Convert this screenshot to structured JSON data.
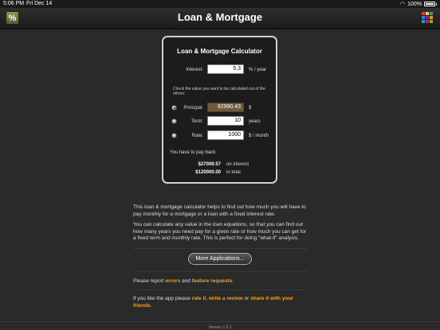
{
  "status": {
    "time": "5:06 PM",
    "date": "Fri Dec 14",
    "battery": "100%"
  },
  "header": {
    "title": "Loan & Mortgage",
    "calc_icon_glyph": "%"
  },
  "calculator": {
    "title": "Loan & Mortgage Calculator",
    "interest_label": "Interest:",
    "interest_value": "5.3",
    "interest_unit": "% / year",
    "hint": "Check the value you want to be calculated out of the others:",
    "principal_label": "Principal:",
    "principal_value": "92990.43",
    "principal_unit": "$",
    "term_label": "Term:",
    "term_value": "10",
    "term_unit": "years",
    "rate_label": "Rate:",
    "rate_value": "1000",
    "rate_unit": "$ / month",
    "payback_label": "You have to pay back:",
    "interest_amount": "$27009.57",
    "interest_amount_label": "on interest",
    "total_amount": "$120000.00",
    "total_amount_label": "in total",
    "selected": "principal"
  },
  "description": {
    "p1": "This loan & mortgage calculator helps to find out how much you will have to pay monthly for a mortgage or a loan with a fixed interest rate.",
    "p2": "You can calculate any value in the loan equations, so that you can find out how many years you need pay for a given rate or how much you can get for a fixed term and monthly rate. This is perfect for doing \"what-if\" analysis."
  },
  "more_apps_label": "More Applications...",
  "report": {
    "prefix": "Please report ",
    "errors_link": "errors",
    "middle": " and ",
    "requests_link": "feature requests",
    "suffix": "."
  },
  "share": {
    "prefix": "If you like the app please ",
    "rate_link": "rate it",
    "comma": ", ",
    "review_link": "write a review",
    "or": " or ",
    "share_link": "share it with your friends",
    "suffix": "."
  },
  "footer": {
    "version": "Version 1.3.1"
  },
  "colors": {
    "accent": "#f0a020",
    "computed_field": "#6e5a3e"
  }
}
